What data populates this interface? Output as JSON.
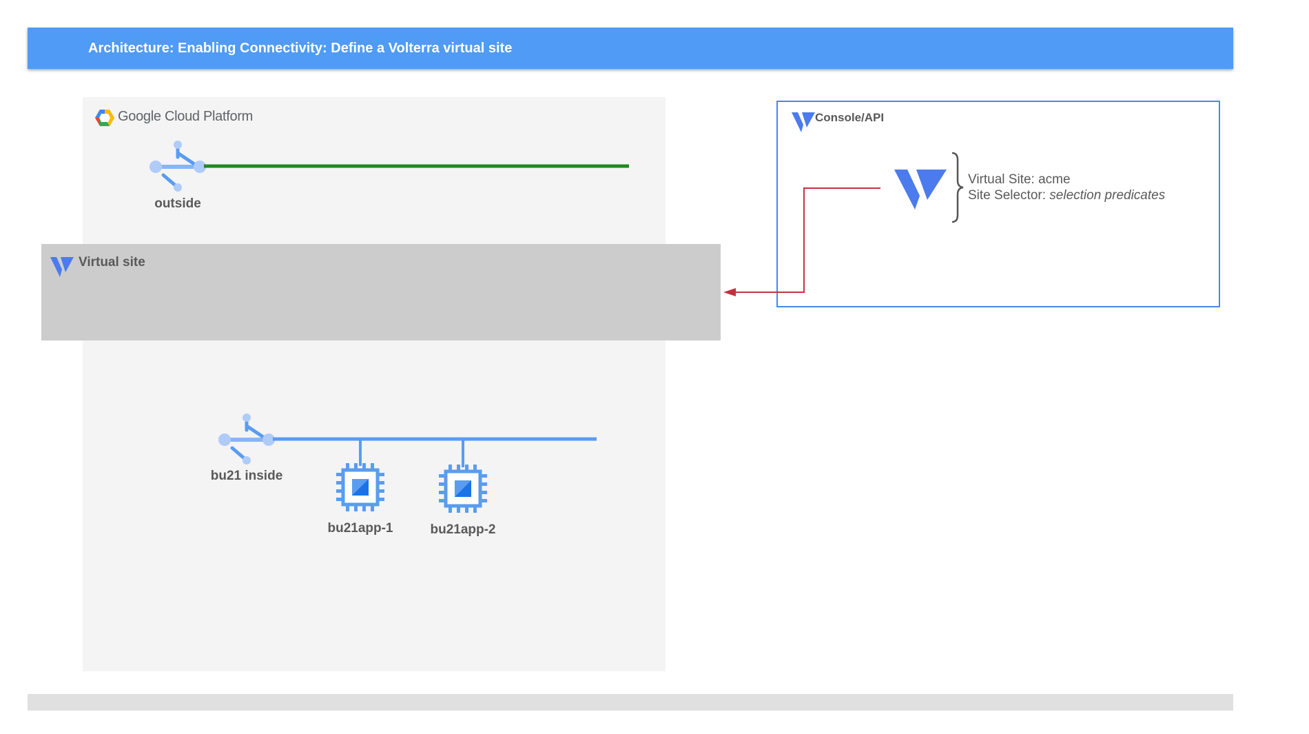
{
  "header": {
    "title": "Architecture: Enabling Connectivity: Define a Volterra virtual site"
  },
  "gcp": {
    "brand_google": "Google",
    "brand_product": "Cloud Platform"
  },
  "networks": {
    "outside": {
      "label": "outside",
      "color": "#1e8a1e"
    },
    "inside": {
      "label": "bu21 inside",
      "color": "#5a9cf0"
    }
  },
  "virtual_site": {
    "label": "Virtual site"
  },
  "console": {
    "label": "Console/API",
    "site_line": "Virtual Site: acme",
    "selector_prefix": "Site Selector: ",
    "selector_value": "selection predicates"
  },
  "vms": [
    {
      "label": "bu21app-1"
    },
    {
      "label": "bu21app-2"
    }
  ],
  "colors": {
    "header": "#4f9bf5",
    "volterra": "#4b7bec",
    "arrow": "#c5303e",
    "panel": "#f4f4f4",
    "band": "#cccccc"
  }
}
